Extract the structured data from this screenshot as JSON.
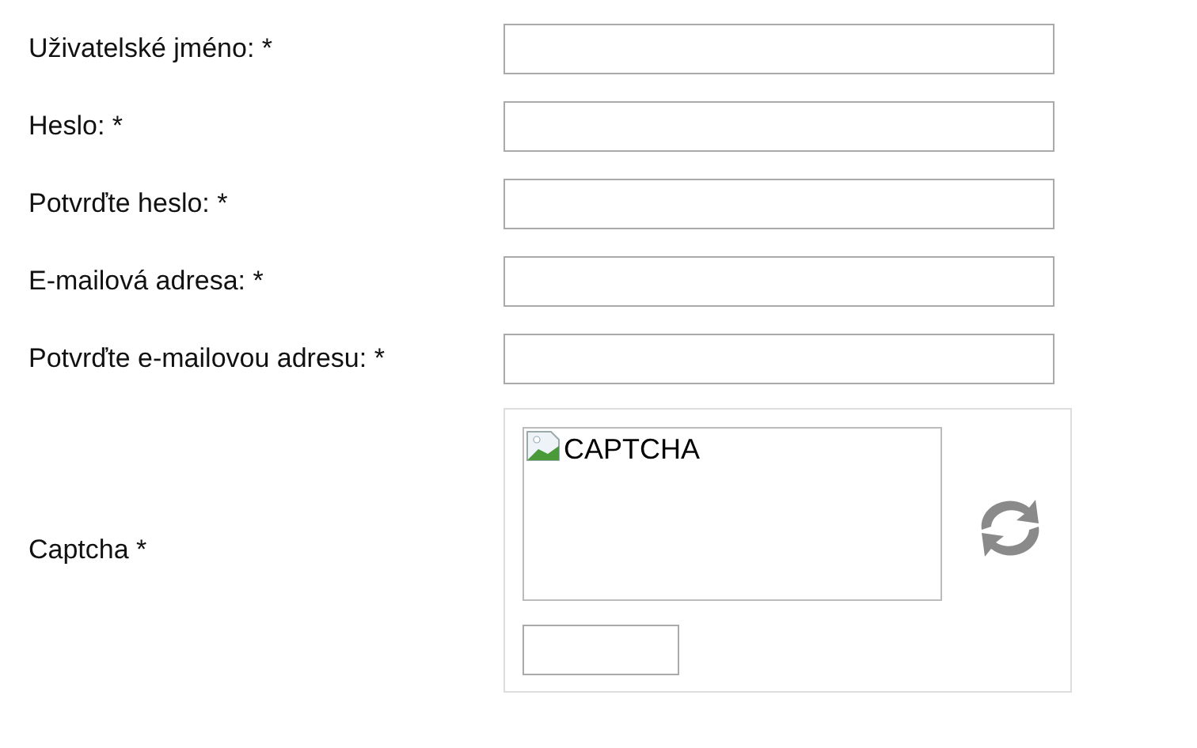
{
  "fields": [
    {
      "label": "Uživatelské jméno: *"
    },
    {
      "label": "Heslo: *"
    },
    {
      "label": "Potvrďte heslo: *"
    },
    {
      "label": "E-mailová adresa: *"
    },
    {
      "label": "Potvrďte e-mailovou adresu: *"
    }
  ],
  "captcha": {
    "label": "Captcha *",
    "image_alt": "CAPTCHA"
  }
}
